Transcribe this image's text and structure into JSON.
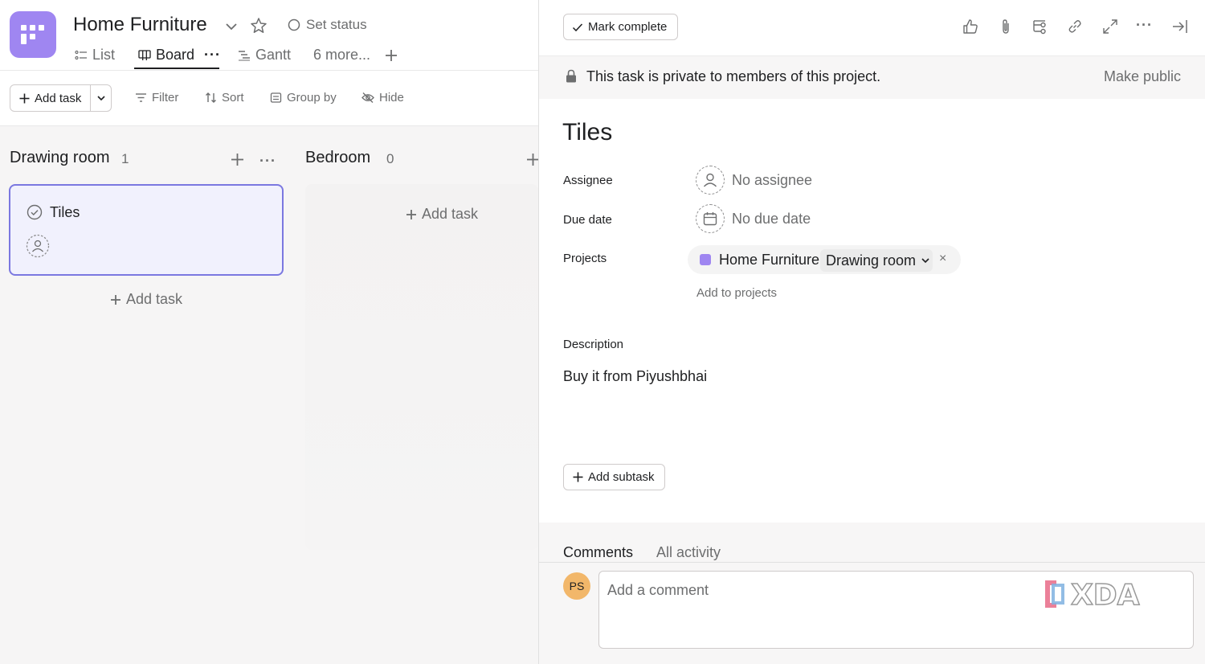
{
  "project": {
    "title": "Home Furniture",
    "color": "#9f86f1",
    "set_status_label": "Set status"
  },
  "tabs": [
    {
      "label": "List",
      "icon": "list-icon",
      "active": false
    },
    {
      "label": "Board",
      "icon": "board-icon",
      "active": true
    },
    {
      "label": "Gantt",
      "icon": "gantt-icon",
      "active": false
    },
    {
      "label": "6 more...",
      "active": false
    }
  ],
  "toolbar": {
    "add_task_label": "Add task",
    "filter_label": "Filter",
    "sort_label": "Sort",
    "group_by_label": "Group by",
    "hide_label": "Hide"
  },
  "board": {
    "columns": [
      {
        "title": "Drawing room",
        "count": "1",
        "cards": [
          {
            "title": "Tiles",
            "assignee": "none"
          }
        ],
        "add_task_label": "Add task"
      },
      {
        "title": "Bedroom",
        "count": "0",
        "cards": [],
        "add_task_label": "Add task"
      }
    ]
  },
  "detail": {
    "mark_complete_label": "Mark complete",
    "privacy_banner": "This task is private to members of this project.",
    "make_public_label": "Make public",
    "task_title": "Tiles",
    "fields": {
      "assignee_label": "Assignee",
      "assignee_value": "No assignee",
      "due_date_label": "Due date",
      "due_date_value": "No due date",
      "projects_label": "Projects",
      "project_name": "Home Furniture",
      "project_section": "Drawing room",
      "remove_symbol": "×",
      "add_to_projects_label": "Add to projects",
      "description_label": "Description",
      "description_value": "Buy it from Piyushbhai"
    },
    "add_subtask_label": "Add subtask",
    "comments": {
      "tab_comments": "Comments",
      "tab_activity": "All activity",
      "avatar_initials": "PS",
      "avatar_color": "#f2b76a",
      "placeholder": "Add a comment"
    },
    "watermark": "XDA"
  },
  "colors": {
    "accent_border": "#7b78e0",
    "card_bg": "#f1f1fd"
  }
}
